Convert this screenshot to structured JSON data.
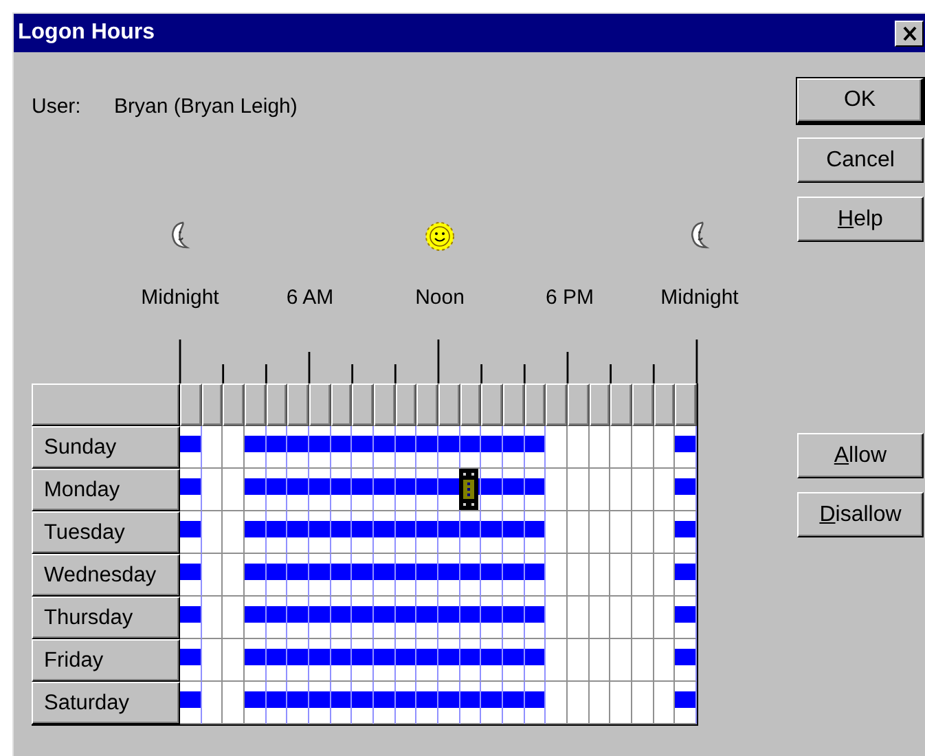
{
  "window": {
    "title": "Logon Hours"
  },
  "user": {
    "label": "User:",
    "value": "Bryan (Bryan Leigh)"
  },
  "time_scale": {
    "labels": [
      "Midnight",
      "6 AM",
      "Noon",
      "6 PM",
      "Midnight"
    ]
  },
  "schedule": {
    "days": [
      {
        "name": "Sunday",
        "hours": [
          true,
          false,
          false,
          true,
          true,
          true,
          true,
          true,
          true,
          true,
          true,
          true,
          true,
          true,
          true,
          true,
          true,
          false,
          false,
          false,
          false,
          false,
          false,
          true
        ]
      },
      {
        "name": "Monday",
        "hours": [
          true,
          false,
          false,
          true,
          true,
          true,
          true,
          true,
          true,
          true,
          true,
          true,
          true,
          true,
          true,
          true,
          true,
          false,
          false,
          false,
          false,
          false,
          false,
          true
        ]
      },
      {
        "name": "Tuesday",
        "hours": [
          true,
          false,
          false,
          true,
          true,
          true,
          true,
          true,
          true,
          true,
          true,
          true,
          true,
          true,
          true,
          true,
          true,
          false,
          false,
          false,
          false,
          false,
          false,
          true
        ]
      },
      {
        "name": "Wednesday",
        "hours": [
          true,
          false,
          false,
          true,
          true,
          true,
          true,
          true,
          true,
          true,
          true,
          true,
          true,
          true,
          true,
          true,
          true,
          false,
          false,
          false,
          false,
          false,
          false,
          true
        ]
      },
      {
        "name": "Thursday",
        "hours": [
          true,
          false,
          false,
          true,
          true,
          true,
          true,
          true,
          true,
          true,
          true,
          true,
          true,
          true,
          true,
          true,
          true,
          false,
          false,
          false,
          false,
          false,
          false,
          true
        ]
      },
      {
        "name": "Friday",
        "hours": [
          true,
          false,
          false,
          true,
          true,
          true,
          true,
          true,
          true,
          true,
          true,
          true,
          true,
          true,
          true,
          true,
          true,
          false,
          false,
          false,
          false,
          false,
          false,
          true
        ]
      },
      {
        "name": "Saturday",
        "hours": [
          true,
          false,
          false,
          true,
          true,
          true,
          true,
          true,
          true,
          true,
          true,
          true,
          true,
          true,
          true,
          true,
          true,
          false,
          false,
          false,
          false,
          false,
          false,
          true
        ]
      }
    ]
  },
  "buttons": [
    {
      "label": "OK",
      "default": true,
      "underlined_access_key": false
    },
    {
      "label": "Cancel",
      "default": false,
      "underlined_access_key": false
    },
    {
      "label": "Help",
      "default": false,
      "underlined_access_key": true
    }
  ],
  "schedule_buttons": [
    {
      "label": "Allow",
      "default": false,
      "underlined_access_key": true
    },
    {
      "label": "Disallow",
      "default": false,
      "underlined_access_key": true
    }
  ]
}
